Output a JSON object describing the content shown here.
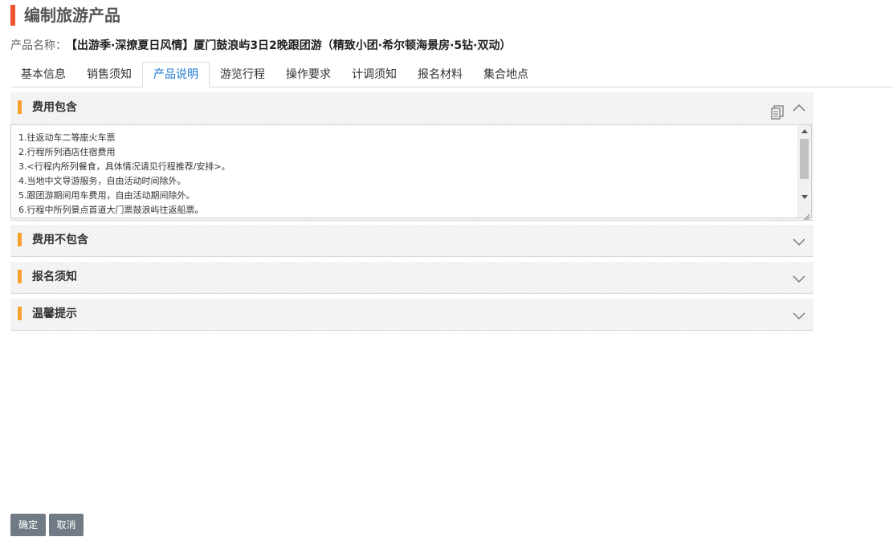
{
  "page": {
    "title": "编制旅游产品"
  },
  "product": {
    "name_label": "产品名称：",
    "name_value": "【出游季·深撩夏日风情】厦门鼓浪屿3日2晚跟团游（精致小团·希尔顿海景房·5钻·双动）"
  },
  "tabs": [
    {
      "label": "基本信息"
    },
    {
      "label": "销售须知"
    },
    {
      "label": "产品说明",
      "active": true
    },
    {
      "label": "游览行程"
    },
    {
      "label": "操作要求"
    },
    {
      "label": "计调须知"
    },
    {
      "label": "报名材料"
    },
    {
      "label": "集合地点"
    }
  ],
  "sections": {
    "fee_included": {
      "title": "费用包含",
      "lines": [
        "1.往返动车二等座火车票",
        "2.行程所列酒店住宿费用",
        "3.<行程内所列餐食，具体情况请见行程推荐/安排>。",
        "4.当地中文导游服务，自由活动时间除外。",
        "5.跟团游期间用车费用，自由活动期间除外。",
        "6.行程中所列景点首道大门票鼓浪屿往返船票。"
      ]
    },
    "fee_excluded": {
      "title": "费用不包含"
    },
    "signup_notice": {
      "title": "报名须知"
    },
    "warm_tips": {
      "title": "温馨提示"
    }
  },
  "buttons": {
    "confirm": "确定",
    "cancel": "取消"
  },
  "colors": {
    "title_bar": "#f0552f",
    "section_bar": "#f5a12c",
    "active_tab": "#1a7ad0",
    "button_bg": "#707b85"
  }
}
